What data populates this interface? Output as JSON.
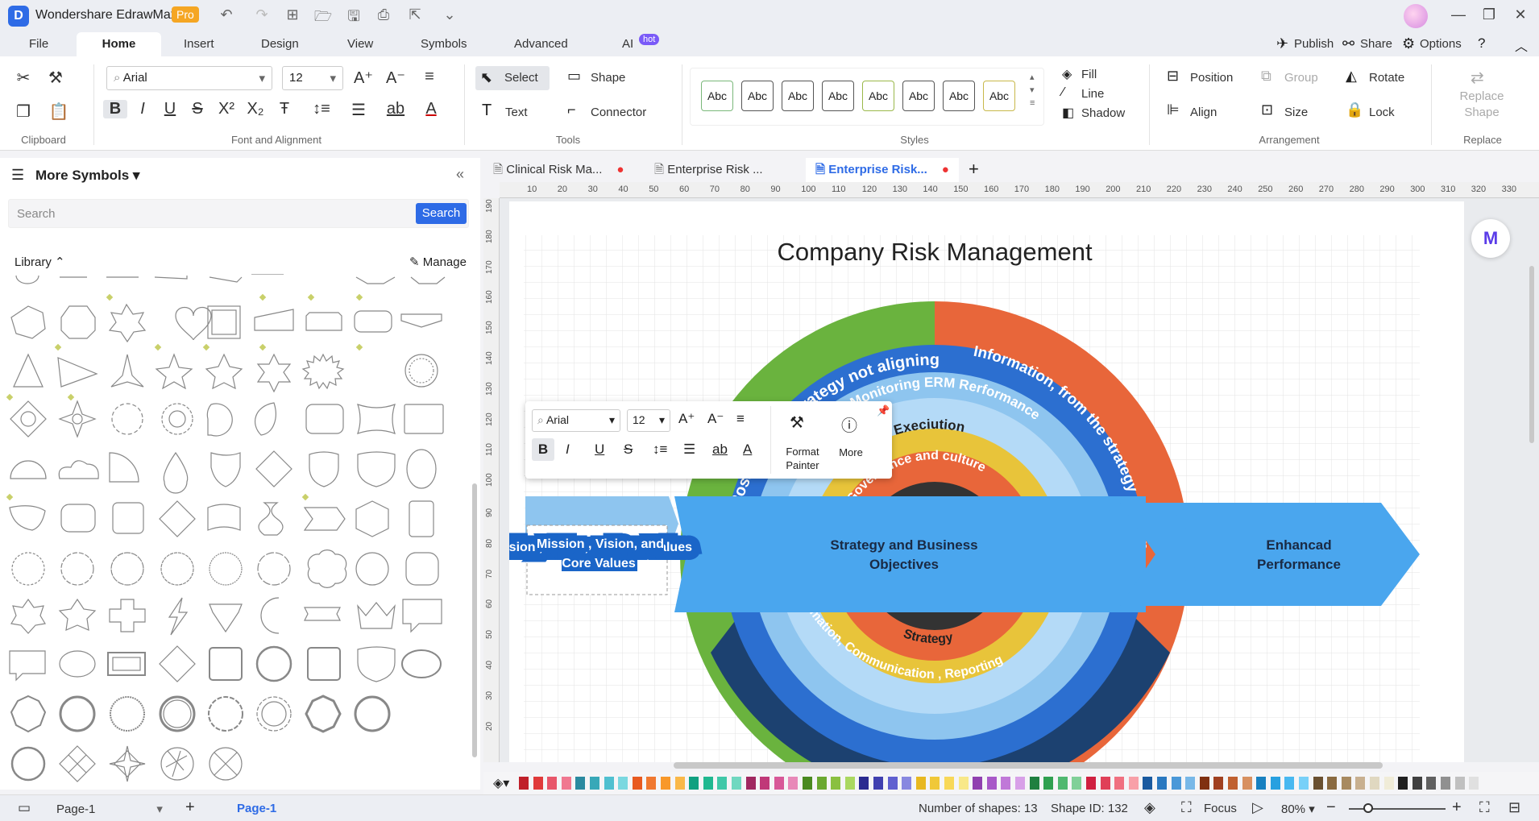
{
  "app": {
    "name": "Wondershare EdrawMax",
    "badge": "Pro"
  },
  "menu": {
    "file": "File",
    "home": "Home",
    "insert": "Insert",
    "design": "Design",
    "view": "View",
    "symbols": "Symbols",
    "advanced": "Advanced",
    "ai": "AI",
    "ai_badge": "hot"
  },
  "top_actions": {
    "publish": "Publish",
    "share": "Share",
    "options": "Options"
  },
  "ribbon": {
    "clipboard_label": "Clipboard",
    "font_label": "Font and Alignment",
    "font_name": "Arial",
    "font_size": "12",
    "tools_label": "Tools",
    "select": "Select",
    "shape": "Shape",
    "text": "Text",
    "connector": "Connector",
    "styles_label": "Styles",
    "style_sample": "Abc",
    "fill": "Fill",
    "line": "Line",
    "shadow": "Shadow",
    "position": "Position",
    "group": "Group",
    "rotate": "Rotate",
    "align": "Align",
    "size": "Size",
    "lock": "Lock",
    "arrangement_label": "Arrangement",
    "replace_shape": "Replace Shape",
    "replace_label": "Replace"
  },
  "left_panel": {
    "title": "More Symbols",
    "search_placeholder": "Search",
    "search_button": "Search",
    "library": "Library",
    "manage": "Manage"
  },
  "tabs": [
    {
      "label": "Clinical Risk Ma..."
    },
    {
      "label": "Enterprise Risk ..."
    },
    {
      "label": "Enterprise Risk..."
    }
  ],
  "ruler_top": [
    "10",
    "20",
    "30",
    "40",
    "50",
    "60",
    "70",
    "80",
    "90",
    "100",
    "110",
    "120",
    "130",
    "140",
    "150",
    "160",
    "170",
    "180",
    "190",
    "200",
    "210",
    "220",
    "230",
    "240",
    "250",
    "260",
    "270",
    "280",
    "290",
    "300",
    "310",
    "320",
    "330"
  ],
  "ruler_left": [
    "190",
    "180",
    "170",
    "160",
    "150",
    "140",
    "130",
    "120",
    "110",
    "100",
    "90",
    "80",
    "70",
    "60",
    "50",
    "40",
    "30",
    "20"
  ],
  "diagram": {
    "title": "Company Risk Management",
    "left_box": "Mission , Vision, and Core Values",
    "center_text_1": "Strategy and Business",
    "center_text_2": "Objectives",
    "right_text_1": "Enhancad",
    "right_text_2": "Performance",
    "ring_outer_left": "Possibility of strategy not aligning",
    "ring_outer_right": "Information, from the strategy chosen",
    "ring_monitoring": "Monitoring ERM Rerformance",
    "ring_execution": "Execiution",
    "ring_governance": "Governance and culture",
    "ring_strategy": "Strategy",
    "ring_info": "Information, Communication , Reporting",
    "colors": {
      "green": "#6ab33e",
      "orange": "#e8663a",
      "navy": "#1c4170",
      "blue": "#2c6fd0",
      "light_blue": "#8ec5ef",
      "pale_blue": "#b4daf7",
      "yellow": "#e8c43a",
      "arrow_blue": "#4aa6ee",
      "dark": "#333333"
    }
  },
  "floatbar": {
    "font": "Arial",
    "size": "12",
    "format_painter_1": "Format",
    "format_painter_2": "Painter",
    "more": "More"
  },
  "status": {
    "page_selector": "Page-1",
    "page_tab": "Page-1",
    "shape_count": "Number of shapes: 13",
    "shape_id": "Shape ID: 132",
    "focus": "Focus",
    "zoom": "80%"
  },
  "palette": [
    "#c0202a",
    "#e03a3a",
    "#e8566a",
    "#f07890",
    "#2a8aa0",
    "#38a8b8",
    "#50c0d0",
    "#7ad8e0",
    "#e85a20",
    "#f07830",
    "#f8982a",
    "#fab848",
    "#10a080",
    "#20b890",
    "#40c8a8",
    "#70d8c0",
    "#a02860",
    "#c03878",
    "#d85898",
    "#e888b8",
    "#4a8a20",
    "#6aa830",
    "#8ac040",
    "#aad860",
    "#2a2a90",
    "#4040b0",
    "#6060d0",
    "#8888e0",
    "#e8b820",
    "#f0c838",
    "#f8d858",
    "#f8e888",
    "#9040b0",
    "#a858c8",
    "#c078d8",
    "#d8a0e8",
    "#208040",
    "#30a050",
    "#50b870",
    "#80d098",
    "#d02040",
    "#e04058",
    "#f07080",
    "#f8a0a8",
    "#1a5aa0",
    "#2a78c0",
    "#4a98d8",
    "#78b8e8",
    "#803010",
    "#a04020",
    "#c06030",
    "#d89060",
    "#1880c0",
    "#28a0e0",
    "#48b8f0",
    "#78d0f8",
    "#6a5030",
    "#8a6a40",
    "#a88a60",
    "#c8b090",
    "#e0d8c0",
    "#f0ecd8",
    "#202020",
    "#404040",
    "#606060",
    "#909090",
    "#c0c0c0",
    "#e0e0e0"
  ]
}
